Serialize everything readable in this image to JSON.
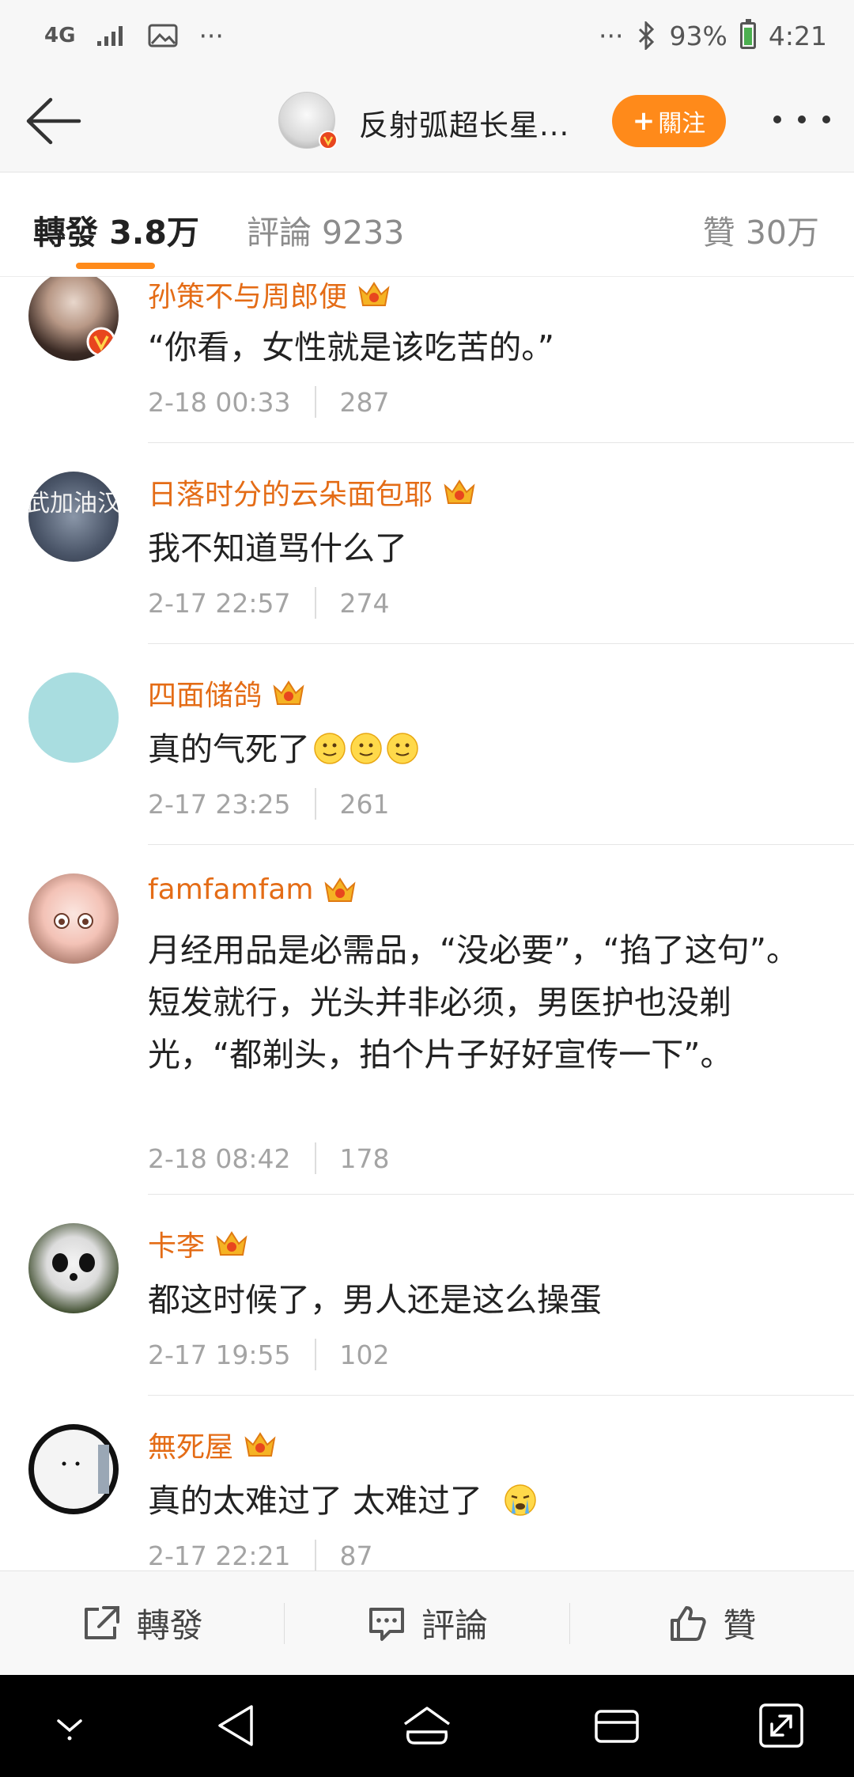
{
  "status_bar": {
    "network": "4G",
    "dots": "···",
    "right_dots": "···",
    "battery": "93%",
    "time": "4:21"
  },
  "header": {
    "title": "反射弧超长星...",
    "follow_label": "關注",
    "follow_plus": "+"
  },
  "tabs": {
    "repost": "轉發 3.8万",
    "comment": "評論 9233",
    "like": "贊 30万"
  },
  "comments": [
    {
      "user": "孙策不与周郎便",
      "text": "“你看，女性就是该吃苦的。”",
      "time": "2-18 00:33",
      "likes": "287"
    },
    {
      "user": "日落时分的云朵面包耶",
      "text": "我不知道骂什么了",
      "time": "2-17 22:57",
      "likes": "274"
    },
    {
      "user": "四面储鸽",
      "text": "真的气死了",
      "time": "2-17 23:25",
      "likes": "261"
    },
    {
      "user": "famfamfam",
      "text": "月经用品是必需品，“没必要”，“掐了这句”。短发就行，光头并非必须，男医护也没剃光，“都剃头，拍个片子好好宣传一下”。",
      "time": "2-18 08:42",
      "likes": "178"
    },
    {
      "user": "卡李",
      "text": "都这时候了，男人还是这么操蛋",
      "time": "2-17 19:55",
      "likes": "102"
    },
    {
      "user": "無死屋",
      "text": "真的太难过了 太难过了",
      "time": "2-17 22:21",
      "likes": "87"
    }
  ],
  "avatar_art": {
    "text": "武加油汉"
  },
  "action_bar": {
    "repost": "轉發",
    "comment": "評論",
    "like": "贊"
  },
  "icons": [
    "back-arrow-icon",
    "more-icon",
    "crown-icon",
    "share-icon",
    "comment-icon",
    "thumb-up-icon",
    "nav-down-icon",
    "nav-back-icon",
    "nav-home-icon",
    "nav-recents-icon",
    "nav-expand-icon"
  ],
  "colors": {
    "accent": "#ff8a1a",
    "username": "#e46c16"
  }
}
